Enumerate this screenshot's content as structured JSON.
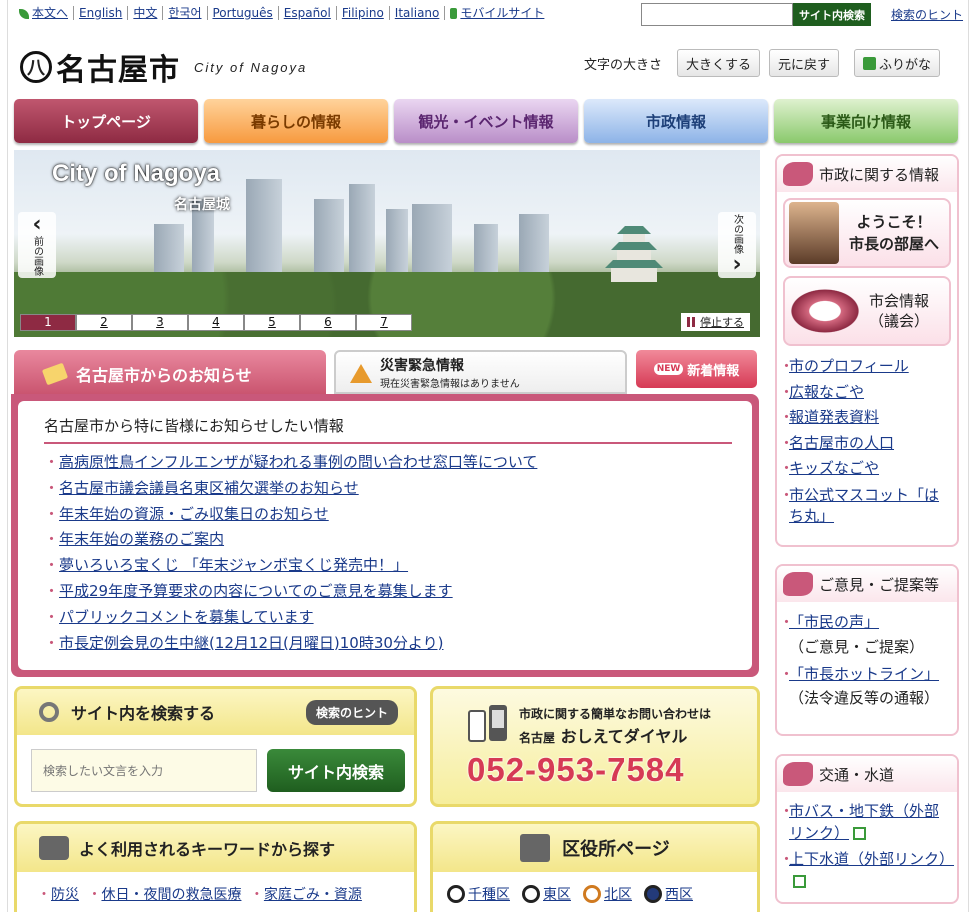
{
  "langbar": {
    "items": [
      "本文へ",
      "English",
      "中文",
      "한국어",
      "Português",
      "Español",
      "Filipino",
      "Italiano",
      "モバイルサイト"
    ]
  },
  "top_search": {
    "placeholder": "",
    "button": "サイト内検索",
    "hint": "検索のヒント"
  },
  "logo": {
    "mark": "八",
    "name": "名古屋市",
    "en": "City of Nagoya"
  },
  "fontsize": {
    "label": "文字の大きさ",
    "bigger": "大きくする",
    "reset": "元に戻す",
    "furigana": "ふりがな"
  },
  "nav": {
    "tabs": [
      "トップページ",
      "暮らしの情報",
      "観光・イベント情報",
      "市政情報",
      "事業向け情報"
    ]
  },
  "hero": {
    "title": "City of Nagoya",
    "caption": "名古屋城",
    "prev": "前の画像",
    "next": "次の画像",
    "pages": [
      "1",
      "2",
      "3",
      "4",
      "5",
      "6",
      "7"
    ],
    "stop": "停止する"
  },
  "notice_tabs": {
    "main": "名古屋市からのお知らせ",
    "disaster_title": "災害緊急情報",
    "disaster_sub": "現在災害緊急情報はありません",
    "new_badge": "NEW",
    "new_label": "新着情報"
  },
  "notices": {
    "heading": "名古屋市から特に皆様にお知らせしたい情報",
    "items": [
      "高病原性鳥インフルエンザが疑われる事例の問い合わせ窓口等について",
      "名古屋市議会議員名東区補欠選挙のお知らせ",
      "年末年始の資源・ごみ収集日のお知らせ",
      "年末年始の業務のご案内",
      "夢いろいろ宝くじ 「年末ジャンボ宝くじ発売中！」",
      "平成29年度予算要求の内容についてのご意見を募集します",
      "パブリックコメントを募集しています",
      "市長定例会見の生中継(12月12日(月曜日)10時30分より)"
    ]
  },
  "site_search": {
    "title": "サイト内を検索する",
    "hint": "検索のヒント",
    "placeholder": "検索したい文言を入力",
    "button": "サイト内検索"
  },
  "dial": {
    "sub": "市政に関する簡単なお問い合わせは",
    "prefix": "名古屋",
    "name": "おしえてダイヤル",
    "number": "052-953-7584"
  },
  "keywords": {
    "title": "よく利用されるキーワードから探す",
    "items": [
      "防災",
      "休日・夜間の救急医療",
      "家庭ごみ・資源"
    ]
  },
  "wards": {
    "title": "区役所ページ",
    "items": [
      "千種区",
      "東区",
      "北区",
      "西区"
    ]
  },
  "sidebar": {
    "policy": {
      "title": "市政に関する情報",
      "mayor_line1": "ようこそ！",
      "mayor_line2": "市長の部屋へ",
      "council_line1": "市会情報",
      "council_line2": "（議会）",
      "links": [
        "市のプロフィール",
        "広報なごや",
        "報道発表資料",
        "名古屋市の人口",
        "キッズなごや",
        "市公式マスコット「はち丸」"
      ]
    },
    "opinion": {
      "title": "ご意見・ご提案等",
      "items": [
        {
          "link": "「市民の声」",
          "note": "（ご意見・ご提案）"
        },
        {
          "link": "「市長ホットライン」",
          "note": "（法令違反等の通報）"
        }
      ]
    },
    "transport": {
      "title": "交通・水道",
      "links": [
        "市バス・地下鉄（外部リンク）",
        "上下水道（外部リンク）"
      ]
    }
  }
}
